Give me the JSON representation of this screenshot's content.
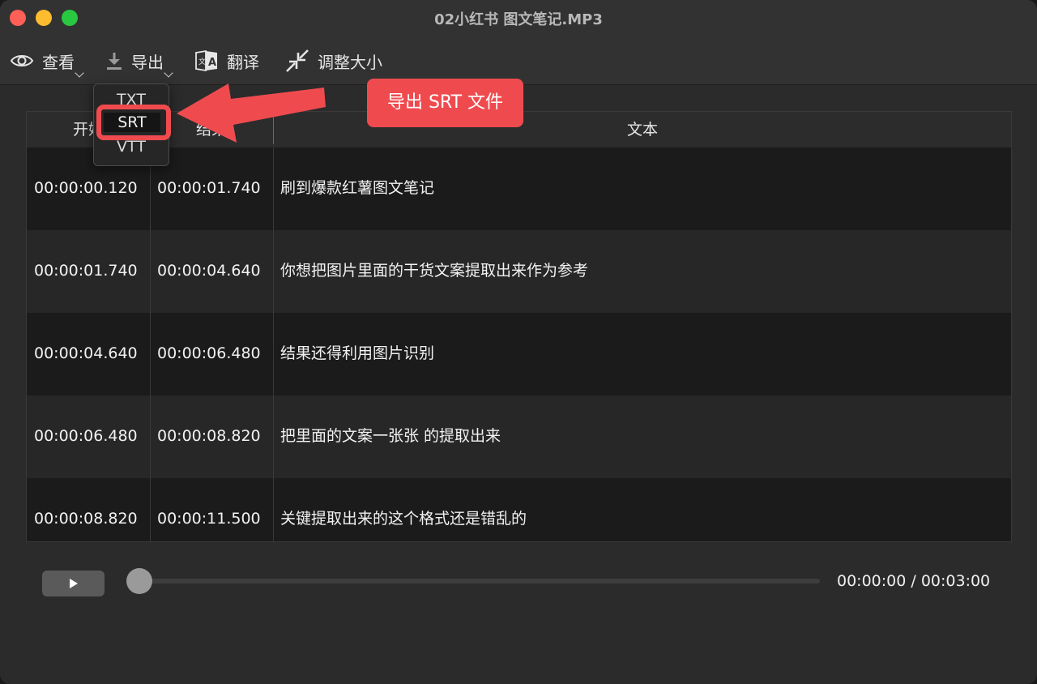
{
  "window": {
    "title": "02小红书 图文笔记.MP3"
  },
  "toolbar": {
    "view_label": "查看",
    "export_label": "导出",
    "translate_label": "翻译",
    "resize_label": "调整大小"
  },
  "export_menu": {
    "items": [
      "TXT",
      "SRT",
      "VTT"
    ]
  },
  "callout": {
    "text": "导出 SRT 文件"
  },
  "table": {
    "headers": [
      "开始",
      "结束",
      "文本"
    ],
    "rows": [
      {
        "start": "00:00:00.120",
        "end": "00:00:01.740",
        "text": "刷到爆款红薯图文笔记"
      },
      {
        "start": "00:00:01.740",
        "end": "00:00:04.640",
        "text": "你想把图片里面的干货文案提取出来作为参考"
      },
      {
        "start": "00:00:04.640",
        "end": "00:00:06.480",
        "text": "结果还得利用图片识别"
      },
      {
        "start": "00:00:06.480",
        "end": "00:00:08.820",
        "text": "把里面的文案一张张 的提取出来"
      },
      {
        "start": "00:00:08.820",
        "end": "00:00:11.500",
        "text": "关键提取出来的这个格式还是错乱的"
      }
    ]
  },
  "player": {
    "time": "00:00:00 / 00:03:00",
    "progress": 0
  },
  "colors": {
    "accent": "#ef4b4f",
    "background": "#2b2b2b"
  },
  "icons": [
    "eye-icon",
    "download-icon",
    "translate-icon",
    "shrink-icon",
    "play-icon"
  ]
}
